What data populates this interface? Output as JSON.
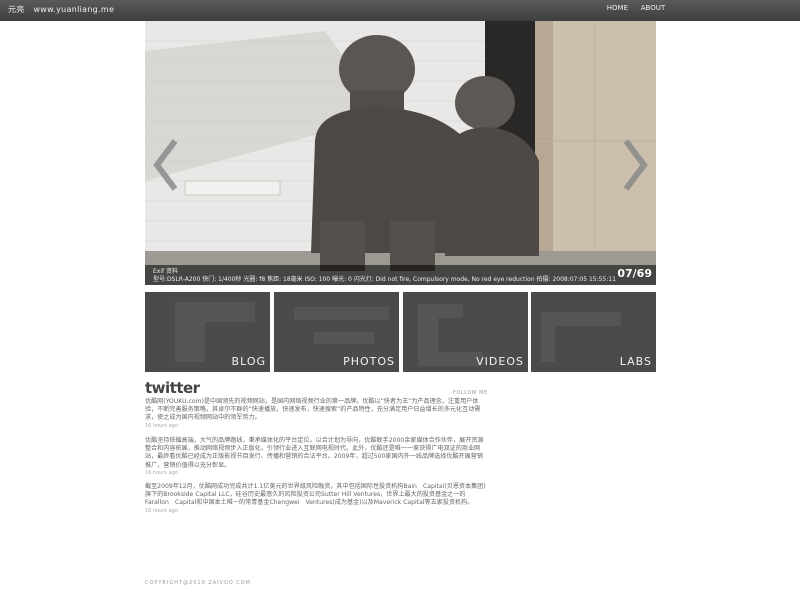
{
  "header": {
    "logo": "元亮",
    "site": "www.yuanliang.me",
    "nav": [
      "HOME",
      "ABOUT"
    ]
  },
  "hero": {
    "caption_title": "Exif 资料",
    "caption_detail": "型号:DSLR-A200 快门: 1/400秒 光圈: f8 焦距: 18毫米 ISO: 100 曝光: 0 闪光灯: Did not fire, Compulsory mode, No red eye reduction 拍摄: 2008:07:05 15:55:11",
    "counter": "07/69"
  },
  "tiles": [
    "BLOG",
    "PHOTOS",
    "VIDEOS",
    "LABS"
  ],
  "twitter": {
    "logo": "twitter",
    "follow": "FOLLOW ME",
    "tweets": [
      {
        "text": "优酷网(YOUKU.com)是中国领先的视频网站，是国内网络视频行业的第一品牌。优酷以“快者为王”为产品理念，注重用户体验，不断完善服务策略，其卓尔不群的“快速播放，快速发布，快速搜索”的产品特性，充分满足用户日益增长的多元化互动需求，使之成为国内视频网站中的领军势力。",
        "time": "16 hours ago"
      },
      {
        "text": "优酷坚持依循高端，大气的品牌路线，秉承媒体化的平台定位，以合计划为导向，优酷联手2000余家媒体合作伙伴，展开资源整合和内容拓展，推动网络视频步入正版化，引领行业进入互联网电视时代。此外，优酷还是唯一一家获得广电双证的商业网站，最终看优酷已经成为正版影视节目发行、传播和营销的合法平台。2009年，超过500家国内外一线品牌选择优酷开展营销推广，营销价值得以充分彰显。",
        "time": "16 hours ago"
      },
      {
        "text": "截至2009年12月，优酷网成功完成共计1.1亿美元的世界级风险融资，其中包括国际性投资机构Bain　Capital(贝恩资本集团)旗下的Brookside Capital LLC，硅谷历史最悠久的风险投资公司Sutter Hill Ventures，世界上最大的投资基金之一的Farallon　Capital和中国本土唯一的常青基金Chengwei　Ventures(成为基金)以及Maverick Capital等五家投资机构。",
        "time": "16 hours ago"
      }
    ]
  },
  "footer": {
    "copyright": "COPYRIGHT@2010 ZAIVOO.COM"
  }
}
